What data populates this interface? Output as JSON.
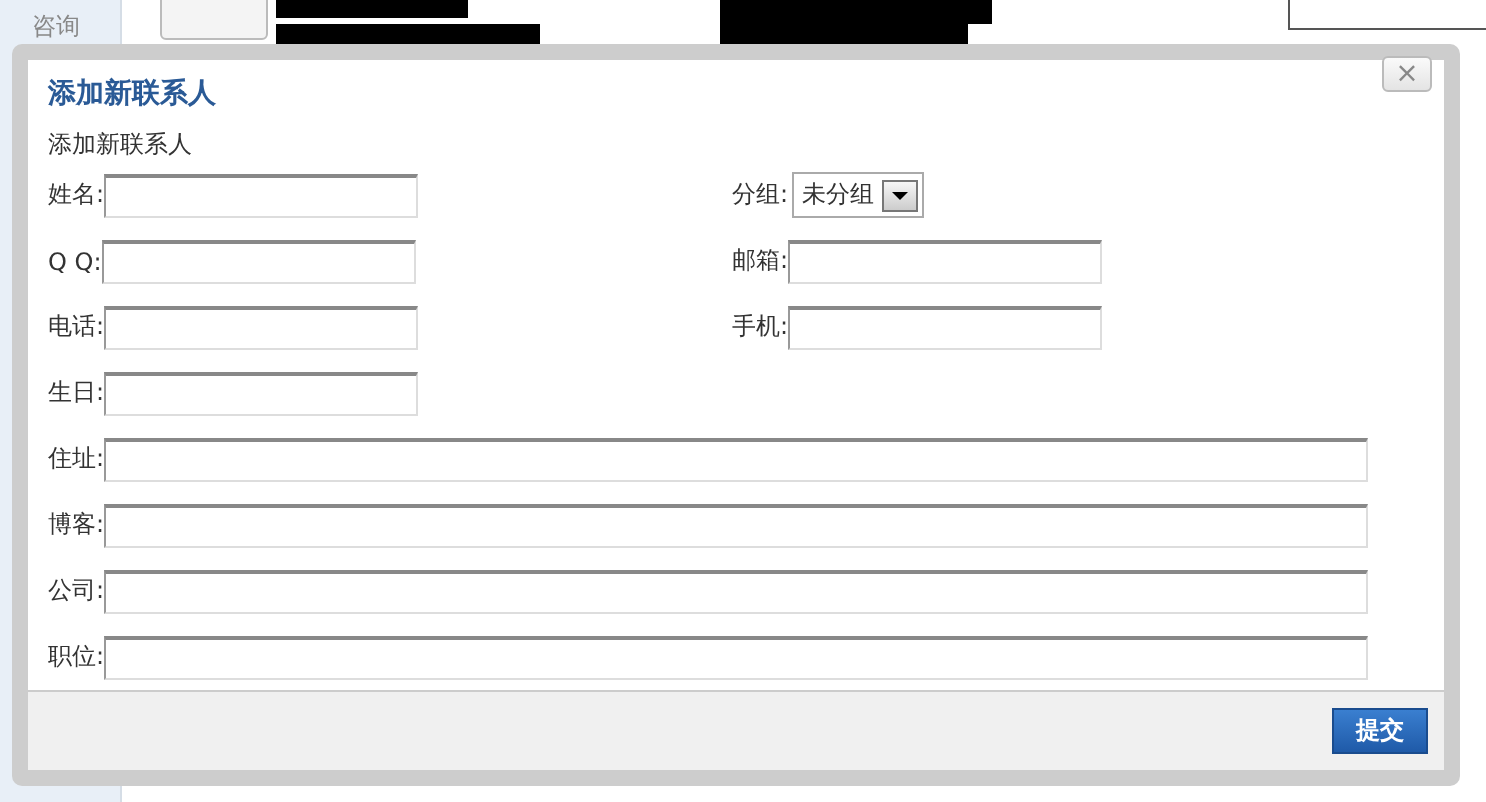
{
  "background": {
    "side_label": "咨询"
  },
  "dialog": {
    "title": "添加新联系人",
    "close": "×",
    "heading": "添加新联系人",
    "rows": [
      {
        "kind": "pair",
        "fields": [
          {
            "label": "姓名:",
            "kind": "text"
          },
          {
            "label": "分组:",
            "kind": "select",
            "value": "未分组"
          }
        ]
      },
      {
        "kind": "pair",
        "fields": [
          {
            "label": "Q Q:",
            "kind": "text"
          },
          {
            "label": "邮箱:",
            "kind": "text"
          }
        ]
      },
      {
        "kind": "pair",
        "fields": [
          {
            "label": "电话:",
            "kind": "text"
          },
          {
            "label": "手机:",
            "kind": "text"
          }
        ]
      },
      {
        "kind": "pair",
        "fields": [
          {
            "label": "生日:",
            "kind": "text"
          }
        ]
      },
      {
        "kind": "wide",
        "fields": [
          {
            "label": "住址:",
            "kind": "text"
          }
        ]
      },
      {
        "kind": "wide",
        "fields": [
          {
            "label": "博客:",
            "kind": "text"
          }
        ]
      },
      {
        "kind": "wide",
        "fields": [
          {
            "label": "公司:",
            "kind": "text"
          }
        ]
      },
      {
        "kind": "wide",
        "fields": [
          {
            "label": "职位:",
            "kind": "text"
          }
        ]
      }
    ],
    "submit": "提交"
  }
}
